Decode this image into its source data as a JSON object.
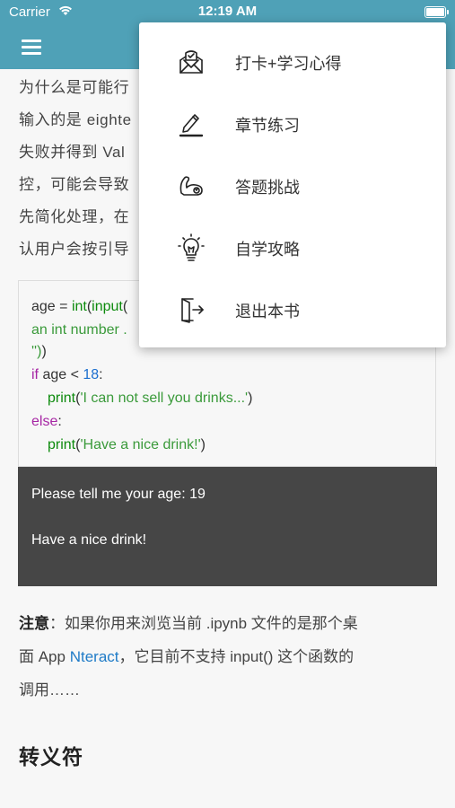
{
  "status_bar": {
    "carrier": "Carrier",
    "time": "12:19 AM",
    "battery_level": 0.95
  },
  "paragraph": {
    "lines": [
      "为什么是可能行",
      "输入的是 eighte",
      "失败并得到 Val",
      "控，可能会导致",
      "先简化处理，在",
      "认用户会按引导"
    ]
  },
  "code": {
    "line1": {
      "var": "age",
      "op": " = ",
      "fn1": "int",
      "p1": "(",
      "fn2": "input",
      "p2": "("
    },
    "line2": " an int number .",
    "line3": "'')",
    "line3b": ")",
    "line4": {
      "kw": "if",
      "var": " age < ",
      "num": "18",
      "colon": ":"
    },
    "line5": {
      "fn": "print",
      "open": "(",
      "str": "'I can not sell you drinks...'",
      "close": ")"
    },
    "line6": {
      "kw": "else",
      "colon": ":"
    },
    "line7": {
      "fn": "print",
      "open": "(",
      "str": "'Have a nice drink!'",
      "close": ")"
    }
  },
  "output": {
    "line1": "Please tell me your age:  19",
    "line2": "Have a nice drink!"
  },
  "note": {
    "label": "注意",
    "text1": "：如果你用来浏览当前 .ipynb 文件的是那个桌",
    "text2_pre": "面 App ",
    "link": "Nteract",
    "text2_post": "，它目前不支持 input() 这个函数的",
    "text3": "调用……"
  },
  "heading": "转义符",
  "menu": {
    "items": [
      {
        "label": "打卡+学习心得",
        "icon": "checkin-notebook-icon"
      },
      {
        "label": "章节练习",
        "icon": "pencil-exercise-icon"
      },
      {
        "label": "答题挑战",
        "icon": "flexed-arm-icon"
      },
      {
        "label": "自学攻略",
        "icon": "lightbulb-icon"
      },
      {
        "label": "退出本书",
        "icon": "exit-door-icon"
      }
    ]
  }
}
